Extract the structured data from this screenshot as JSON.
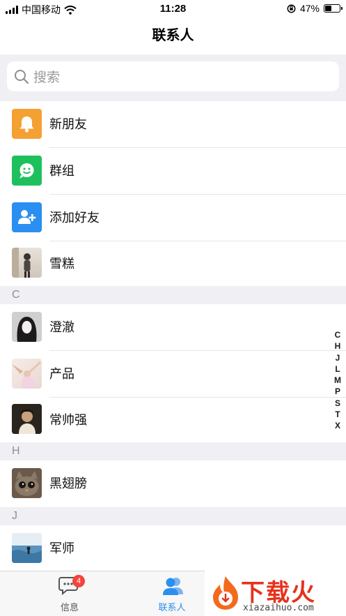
{
  "status_bar": {
    "carrier": "中国移动",
    "time": "11:28",
    "battery_text": "47%",
    "battery_level": 0.47
  },
  "nav": {
    "title": "联系人"
  },
  "search": {
    "placeholder": "搜索"
  },
  "features": [
    {
      "label": "新朋友",
      "icon": "bell-icon",
      "color": "#f5a033"
    },
    {
      "label": "群组",
      "icon": "chat-icon",
      "color": "#1ec05e"
    },
    {
      "label": "添加好友",
      "icon": "add-user-icon",
      "color": "#2a8ff0"
    }
  ],
  "sections": [
    {
      "letter": "",
      "contacts": [
        "雪糕"
      ]
    },
    {
      "letter": "C",
      "contacts": [
        "澄澈",
        "产品",
        "常帅强"
      ]
    },
    {
      "letter": "H",
      "contacts": [
        "黑翅膀"
      ]
    },
    {
      "letter": "J",
      "contacts": [
        "军师"
      ]
    }
  ],
  "index_letters": [
    "C",
    "H",
    "J",
    "L",
    "M",
    "P",
    "S",
    "T",
    "X"
  ],
  "tabs": [
    {
      "label": "信息",
      "icon": "message-icon",
      "badge": "4",
      "active": false
    },
    {
      "label": "联系人",
      "icon": "contacts-icon",
      "active": true
    }
  ],
  "watermark": {
    "text": "下载火",
    "url": "xiazaihuo.com"
  },
  "colors": {
    "active_tab": "#2a8ff0",
    "inactive_tab": "#555555",
    "badge": "#f2453d"
  }
}
